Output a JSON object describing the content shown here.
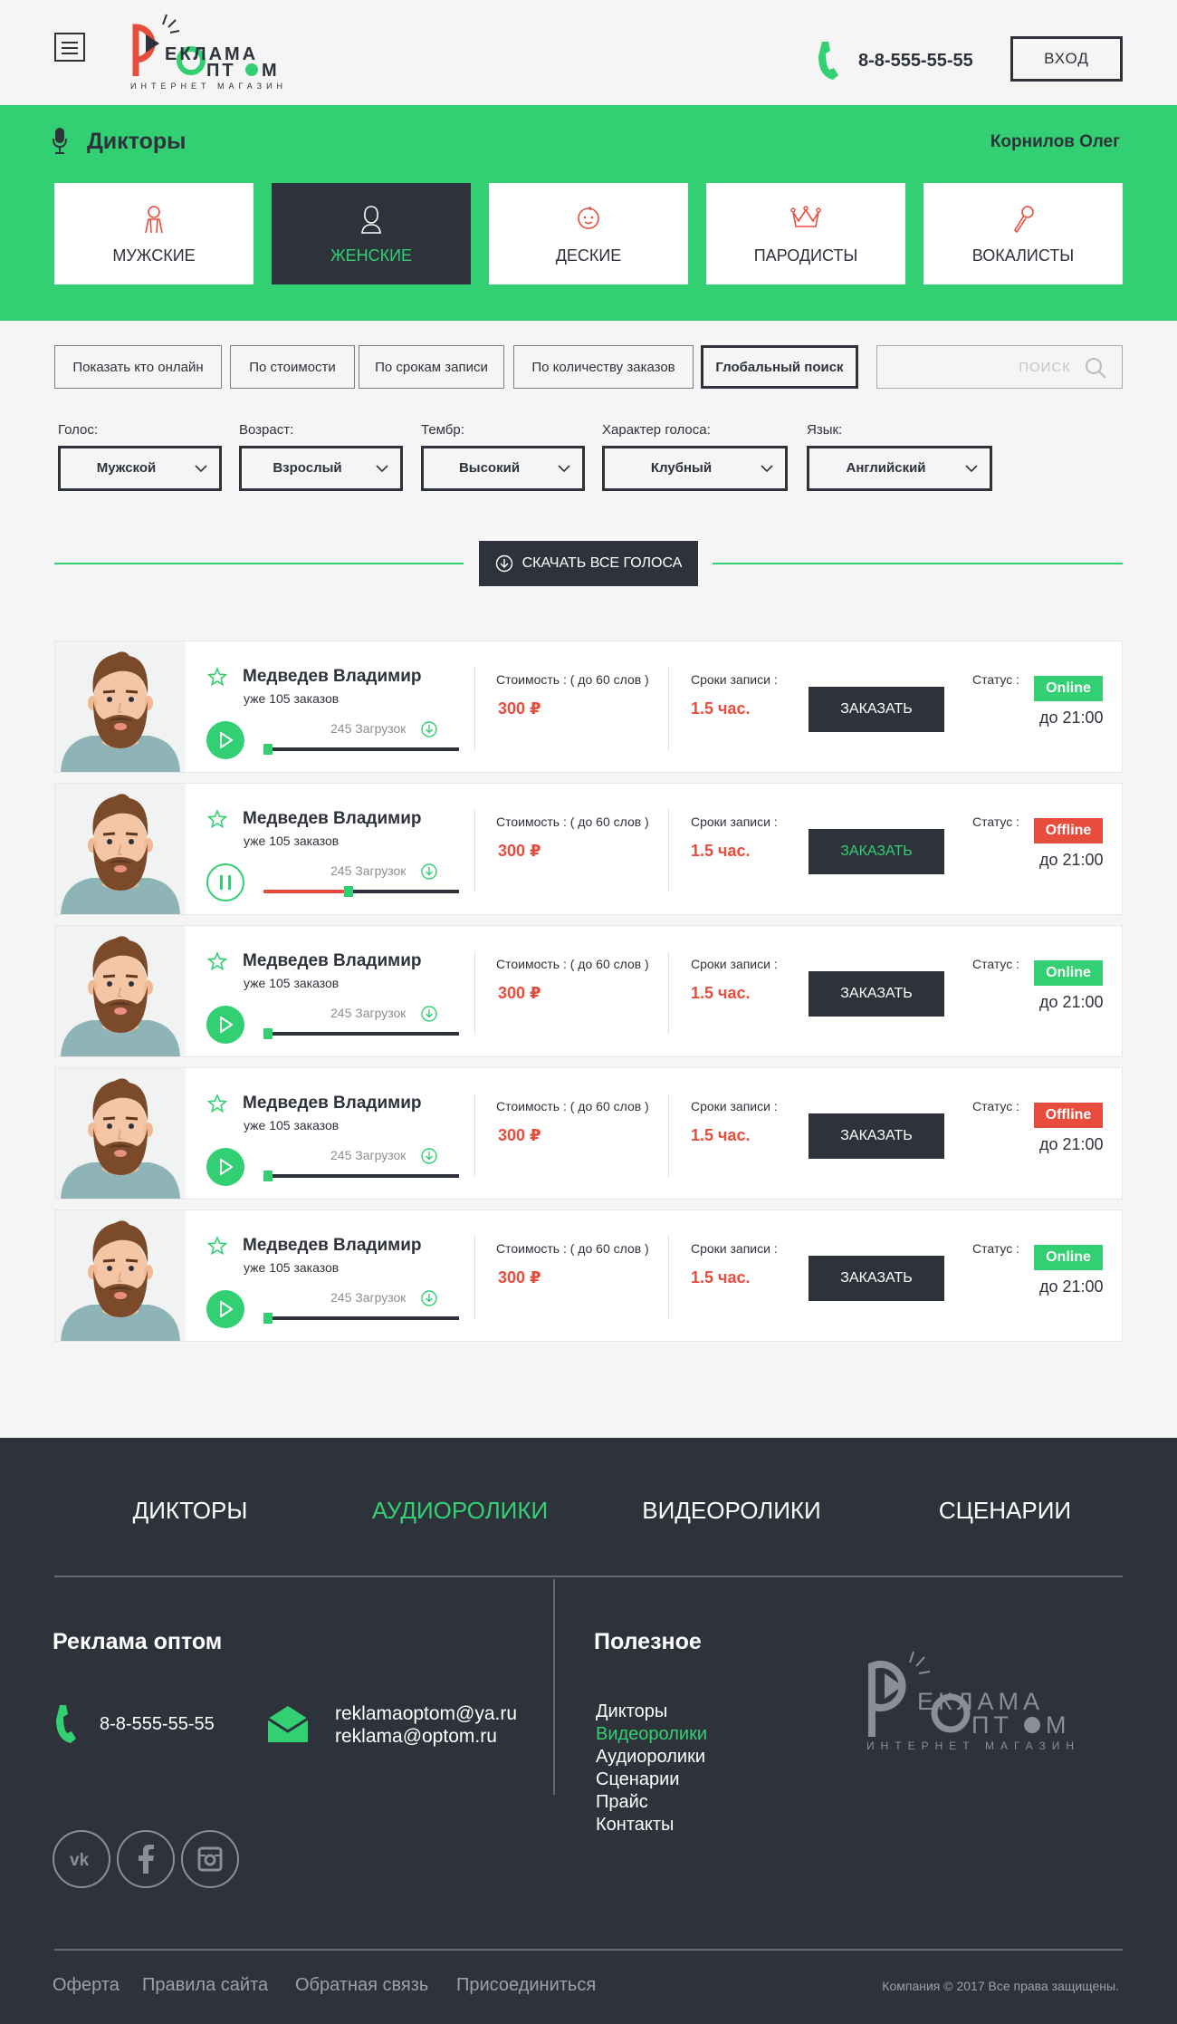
{
  "header": {
    "phone": "8-8-555-55-55",
    "login_label": "ВХОД",
    "logo": {
      "brand_line1": "ЕКЛАМА",
      "brand_line2": "ПТ",
      "brand_line2b": "М",
      "tagline": "ИНТЕРНЕТ МАГАЗИН"
    }
  },
  "section": {
    "title": "Дикторы",
    "user": "Корнилов Олег"
  },
  "categories": [
    {
      "label": "МУЖСКИЕ",
      "icon": "male-icon",
      "active": false
    },
    {
      "label": "ЖЕНСКИЕ",
      "icon": "female-icon",
      "active": true
    },
    {
      "label": "ДЕСКИЕ",
      "icon": "baby-icon",
      "active": false
    },
    {
      "label": "ПАРОДИСТЫ",
      "icon": "crown-icon",
      "active": false
    },
    {
      "label": "ВОКАЛИСТЫ",
      "icon": "microphone-icon",
      "active": false
    }
  ],
  "filters": {
    "buttons": [
      "Показать кто онлайн",
      "По стоимости",
      "По срокам записи",
      "По количеству заказов",
      "Глобальный поиск"
    ],
    "search_placeholder": "ПОИСК"
  },
  "selects": [
    {
      "label": "Голос:",
      "value": "Мужской"
    },
    {
      "label": "Возраст:",
      "value": "Взрослый"
    },
    {
      "label": "Тембр:",
      "value": "Высокий"
    },
    {
      "label": "Характер голоса:",
      "value": "Клубный"
    },
    {
      "label": "Язык:",
      "value": "Английский"
    }
  ],
  "download_all_label": "СКАЧАТЬ ВСЕ ГОЛОСА",
  "labels": {
    "cost": "Стоимость :  ( до 60 слов )",
    "term": "Сроки записи :",
    "status": "Статус :"
  },
  "speakers": [
    {
      "name": "Медведев Владимир",
      "orders": "уже 105 заказов",
      "downloads": "245 Загрузок",
      "price": "300 ₽",
      "term": "1.5 час.",
      "order_label": "ЗАКАЗАТЬ",
      "status": "Online",
      "until": "до 21:00",
      "playing": false,
      "progress": 0
    },
    {
      "name": "Медведев Владимир",
      "orders": "уже 105 заказов",
      "downloads": "245 Загрузок",
      "price": "300 ₽",
      "term": "1.5 час.",
      "order_label": "ЗАКАЗАТЬ",
      "status": "Offline",
      "until": "до 21:00",
      "playing": true,
      "progress": 0.42
    },
    {
      "name": "Медведев Владимир",
      "orders": "уже 105 заказов",
      "downloads": "245 Загрузок",
      "price": "300 ₽",
      "term": "1.5 час.",
      "order_label": "ЗАКАЗАТЬ",
      "status": "Online",
      "until": "до 21:00",
      "playing": false,
      "progress": 0
    },
    {
      "name": "Медведев Владимир",
      "orders": "уже 105 заказов",
      "downloads": "245 Загрузок",
      "price": "300 ₽",
      "term": "1.5 час.",
      "order_label": "ЗАКАЗАТЬ",
      "status": "Offline",
      "until": "до 21:00",
      "playing": false,
      "progress": 0
    },
    {
      "name": "Медведев Владимир",
      "orders": "уже 105 заказов",
      "downloads": "245 Загрузок",
      "price": "300 ₽",
      "term": "1.5 час.",
      "order_label": "ЗАКАЗАТЬ",
      "status": "Online",
      "until": "до 21:00",
      "playing": false,
      "progress": 0
    }
  ],
  "footer": {
    "nav": [
      {
        "label": "ДИКТОРЫ",
        "active": false
      },
      {
        "label": "АУДИОРОЛИКИ",
        "active": true
      },
      {
        "label": "ВИДЕОРОЛИКИ",
        "active": false
      },
      {
        "label": "СЦЕНАРИИ",
        "active": false
      }
    ],
    "company_title": "Реклама оптом",
    "phone": "8-8-555-55-55",
    "emails": [
      "reklamaoptom@ya.ru",
      "reklama@optom.ru"
    ],
    "useful_title": "Полезное",
    "useful_links": [
      {
        "label": "Дикторы",
        "active": false
      },
      {
        "label": "Видеоролики",
        "active": true
      },
      {
        "label": "Аудиоролики",
        "active": false
      },
      {
        "label": "Сценарии",
        "active": false
      },
      {
        "label": "Прайс",
        "active": false
      },
      {
        "label": "Контакты",
        "active": false
      }
    ],
    "socials": [
      "vk-icon",
      "facebook-icon",
      "instagram-icon"
    ],
    "bottom_links": [
      "Оферта",
      "Правила сайта",
      "Обратная связь",
      "Присоединиться"
    ],
    "copyright": "Компания © 2017  Все права защищены."
  },
  "colors": {
    "accent": "#32d073",
    "dark": "#2e323a",
    "danger": "#e84c3d",
    "bg": "#f4f5f4"
  }
}
